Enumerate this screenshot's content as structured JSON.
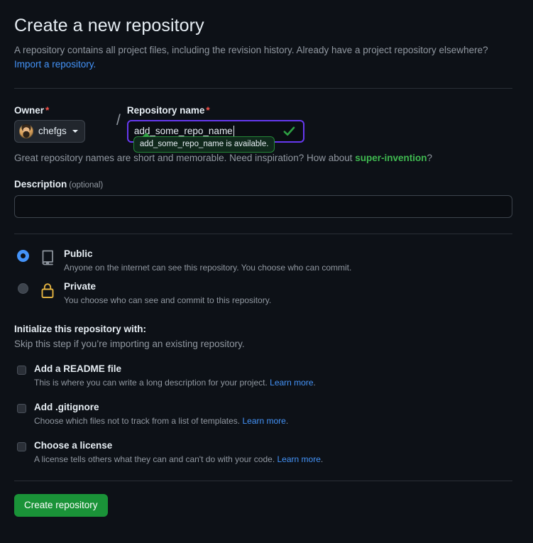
{
  "header": {
    "title": "Create a new repository",
    "lead": "A repository contains all project files, including the revision history. Already have a project repository elsewhere?",
    "import_link": "Import a repository."
  },
  "owner": {
    "label": "Owner",
    "required_mark": "*",
    "name": "chefgs",
    "avatar_icon": "user-avatar-photo",
    "caret_icon": "caret-down-icon"
  },
  "separator": "/",
  "repository_name": {
    "label": "Repository name",
    "required_mark": "*",
    "value": "add_some_repo_name",
    "valid_icon": "check-icon",
    "tooltip": "add_some_repo_name is available."
  },
  "hint": {
    "prefix": "Great repository names are short and memorable. Need inspiration? How about ",
    "suggestion": "super-invention",
    "suffix": "?"
  },
  "description": {
    "label": "Description",
    "optional": "(optional)",
    "value": "",
    "placeholder": ""
  },
  "visibility": [
    {
      "id": "public",
      "title": "Public",
      "desc": "Anyone on the internet can see this repository. You choose who can commit.",
      "icon": "repo-icon",
      "selected": true
    },
    {
      "id": "private",
      "title": "Private",
      "desc": "You choose who can see and commit to this repository.",
      "icon": "lock-icon",
      "selected": false
    }
  ],
  "initialize": {
    "heading": "Initialize this repository with:",
    "subheading": "Skip this step if you’re importing an existing repository.",
    "options": [
      {
        "id": "readme",
        "title": "Add a README file",
        "desc": "This is where you can write a long description for your project. ",
        "link": "Learn more",
        "desc_end": ".",
        "checked": false
      },
      {
        "id": "gitignore",
        "title": "Add .gitignore",
        "desc": "Choose which files not to track from a list of templates. ",
        "link": "Learn more",
        "desc_end": ".",
        "checked": false
      },
      {
        "id": "license",
        "title": "Choose a license",
        "desc": "A license tells others what they can and can't do with your code. ",
        "link": "Learn more",
        "desc_end": ".",
        "checked": false
      }
    ]
  },
  "submit": {
    "label": "Create repository"
  },
  "colors": {
    "background": "#0d1117",
    "accent_link": "#4493f8",
    "success_green": "#3fb950",
    "button_green": "#1a9338",
    "focus_purple": "#6639ef",
    "lock_yellow": "#e3b341",
    "required_red": "#f85149",
    "text_primary": "#e6edf3",
    "text_muted": "#9198a1"
  }
}
